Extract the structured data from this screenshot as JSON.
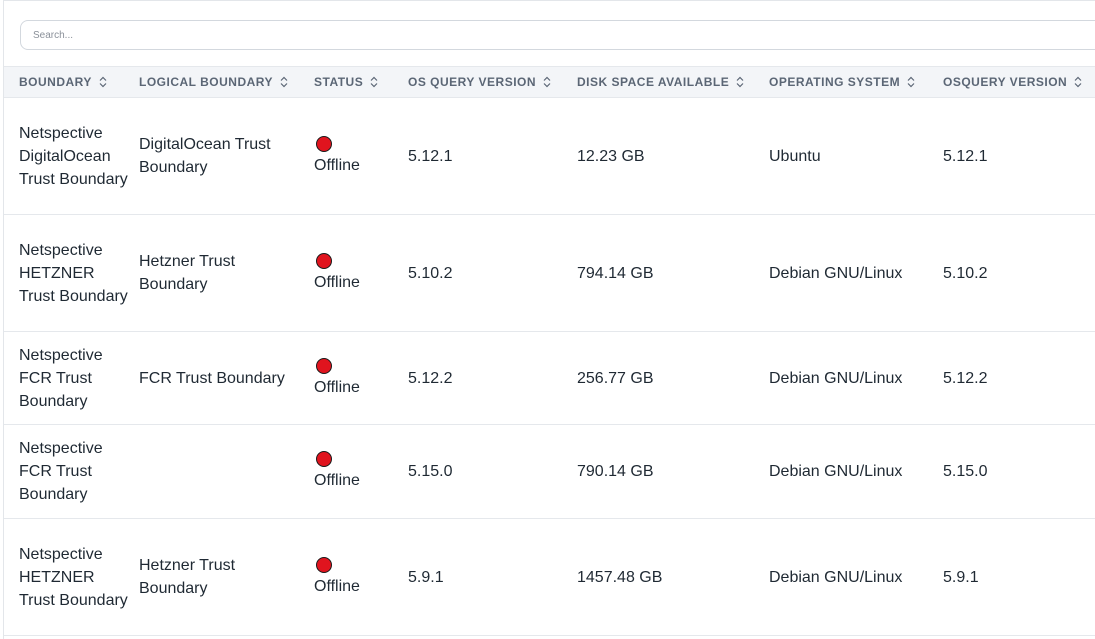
{
  "search": {
    "placeholder": "Search..."
  },
  "columns": [
    "BOUNDARY",
    "LOGICAL BOUNDARY",
    "STATUS",
    "OS QUERY VERSION",
    "DISK SPACE AVAILABLE",
    "OPERATING SYSTEM",
    "OSQUERY VERSION"
  ],
  "rows": [
    {
      "boundary": "Netspective DigitalOcean Trust Boundary",
      "logical_boundary": "DigitalOcean Trust Boundary",
      "status": "Offline",
      "os_query_version": "5.12.1",
      "disk_space": "12.23 GB",
      "operating_system": "Ubuntu",
      "osquery_version": "5.12.1"
    },
    {
      "boundary": "Netspective HETZNER Trust Boundary",
      "logical_boundary": "Hetzner Trust Boundary",
      "status": "Offline",
      "os_query_version": "5.10.2",
      "disk_space": "794.14 GB",
      "operating_system": "Debian GNU/Linux",
      "osquery_version": "5.10.2"
    },
    {
      "boundary": "Netspective FCR Trust Boundary",
      "logical_boundary": "FCR Trust Boundary",
      "status": "Offline",
      "os_query_version": "5.12.2",
      "disk_space": "256.77 GB",
      "operating_system": "Debian GNU/Linux",
      "osquery_version": "5.12.2"
    },
    {
      "boundary": "Netspective FCR Trust Boundary",
      "logical_boundary": "",
      "status": "Offline",
      "os_query_version": "5.15.0",
      "disk_space": "790.14 GB",
      "operating_system": "Debian GNU/Linux",
      "osquery_version": "5.15.0"
    },
    {
      "boundary": "Netspective HETZNER Trust Boundary",
      "logical_boundary": "Hetzner Trust Boundary",
      "status": "Offline",
      "os_query_version": "5.9.1",
      "disk_space": "1457.48 GB",
      "operating_system": "Debian GNU/Linux",
      "osquery_version": "5.9.1"
    }
  ],
  "icons": {
    "sort": "sort-icon",
    "status": "status-dot-icon"
  },
  "colors": {
    "status_offline": "#e0141e",
    "header_bg": "#f3f5f8"
  }
}
